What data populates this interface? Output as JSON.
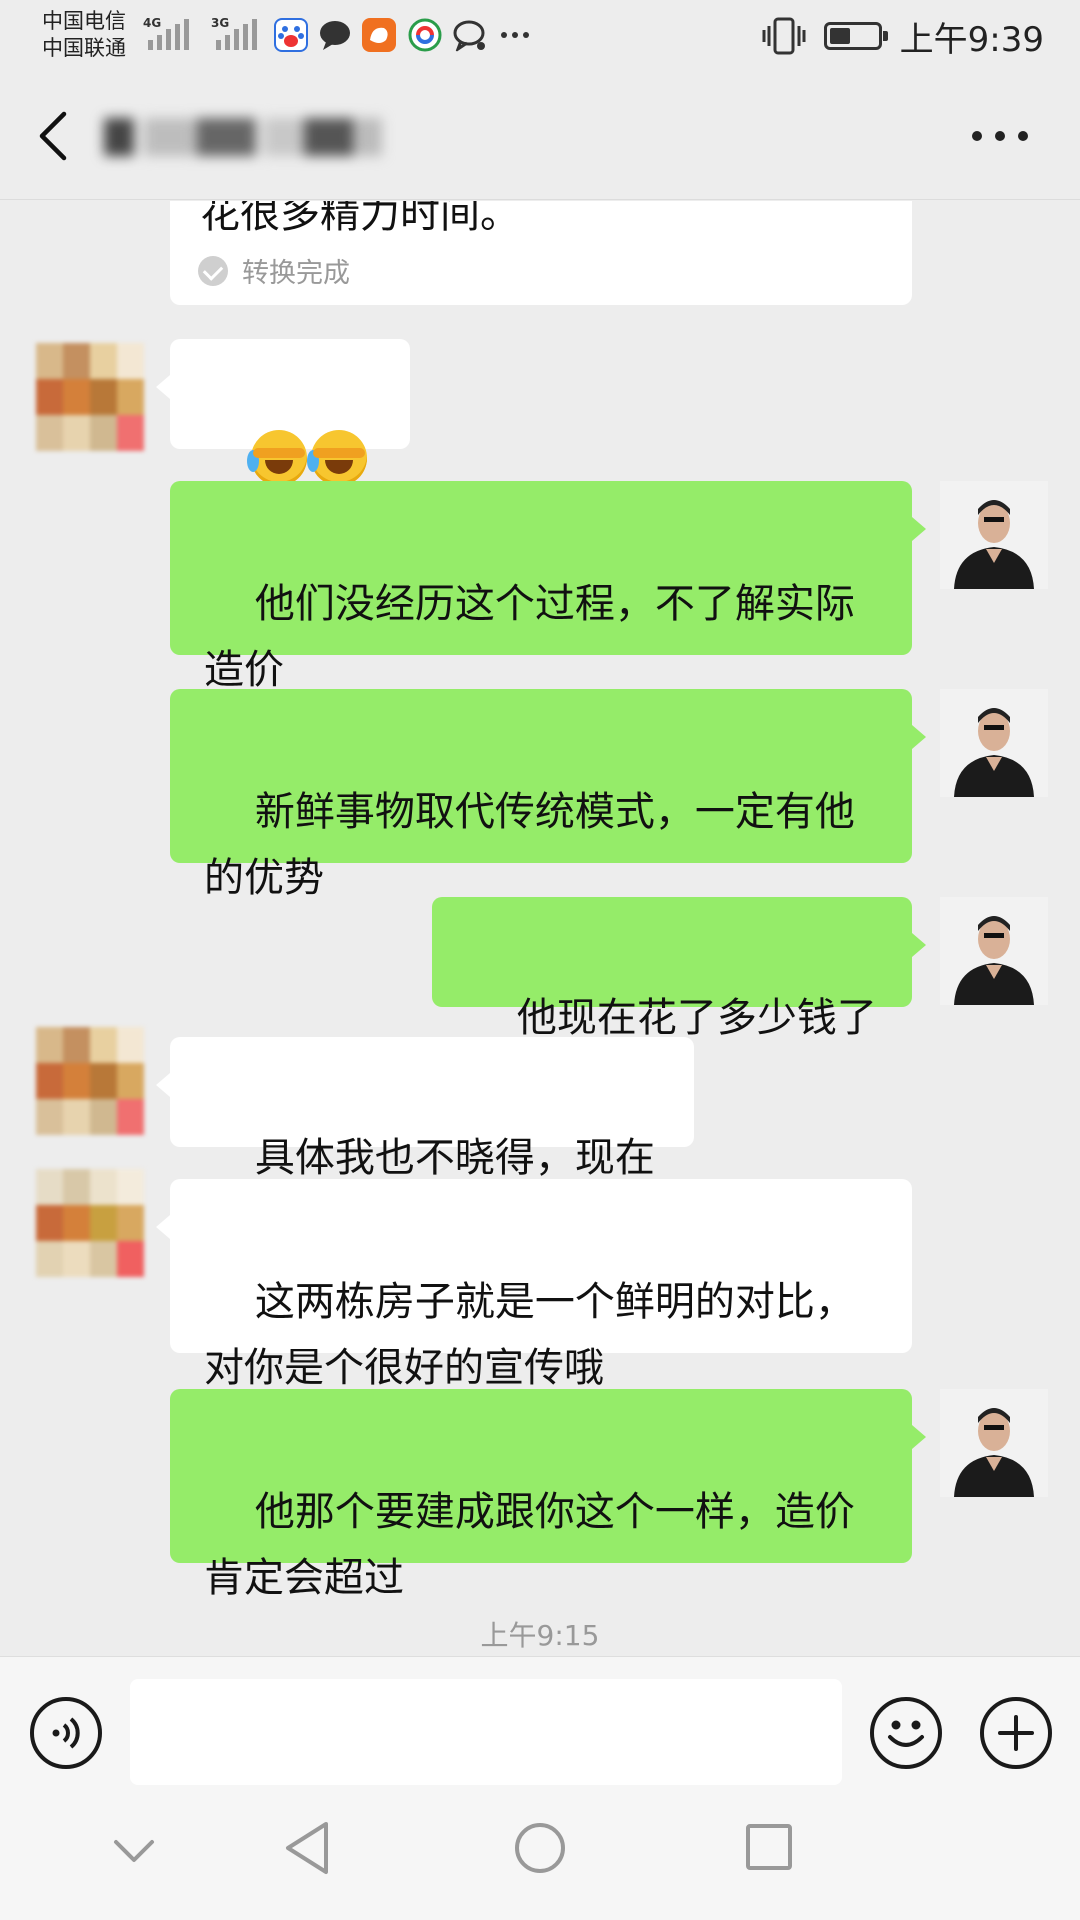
{
  "status_bar": {
    "carrier_1": "中国电信",
    "carrier_2": "中国联通",
    "network_1": "4G",
    "network_2": "3G",
    "notification_icons": [
      "baidu-icon",
      "chat-bubble-icon",
      "uc-browser-icon",
      "news-app-icon",
      "messages-icon",
      "more-dots-icon"
    ],
    "vibrate_icon": "vibrate-icon",
    "battery_level": 0.45,
    "time": "上午9:39"
  },
  "header": {
    "back_icon": "back-chevron-icon",
    "title_obscured": true,
    "more_icon": "more-dots-icon"
  },
  "messages": [
    {
      "side": "left",
      "type": "voice-to-text",
      "text": "花很多精力时间。",
      "status": "转换完成"
    },
    {
      "side": "left",
      "type": "emoji",
      "emoji": [
        "facepalm-crying-emoji",
        "facepalm-crying-emoji",
        "facepalm-crying-emoji"
      ]
    },
    {
      "side": "right",
      "text": "他们没经历这个过程，不了解实际\n造价"
    },
    {
      "side": "right",
      "text": "新鲜事物取代传统模式，一定有他\n的优势"
    },
    {
      "side": "right",
      "text": "他现在花了多少钱了"
    },
    {
      "side": "left",
      "text": "具体我也不晓得，现在"
    },
    {
      "side": "left",
      "text": "这两栋房子就是一个鲜明的对比，\n对你是个很好的宣传哦"
    },
    {
      "side": "right",
      "text": "他那个要建成跟你这个一样，造价\n肯定会超过"
    }
  ],
  "timestamp": "上午9:15",
  "input_bar": {
    "voice_icon": "voice-input-icon",
    "input_value": "",
    "emoji_icon": "emoji-smile-icon",
    "plus_icon": "plus-circle-icon"
  },
  "nav_bar": {
    "icons": [
      "hide-keyboard-chevron-icon",
      "back-triangle-icon",
      "home-circle-icon",
      "recents-square-icon"
    ]
  },
  "colors": {
    "background": "#ededed",
    "bubble_mine": "#95ec69",
    "bubble_theirs": "#ffffff"
  }
}
